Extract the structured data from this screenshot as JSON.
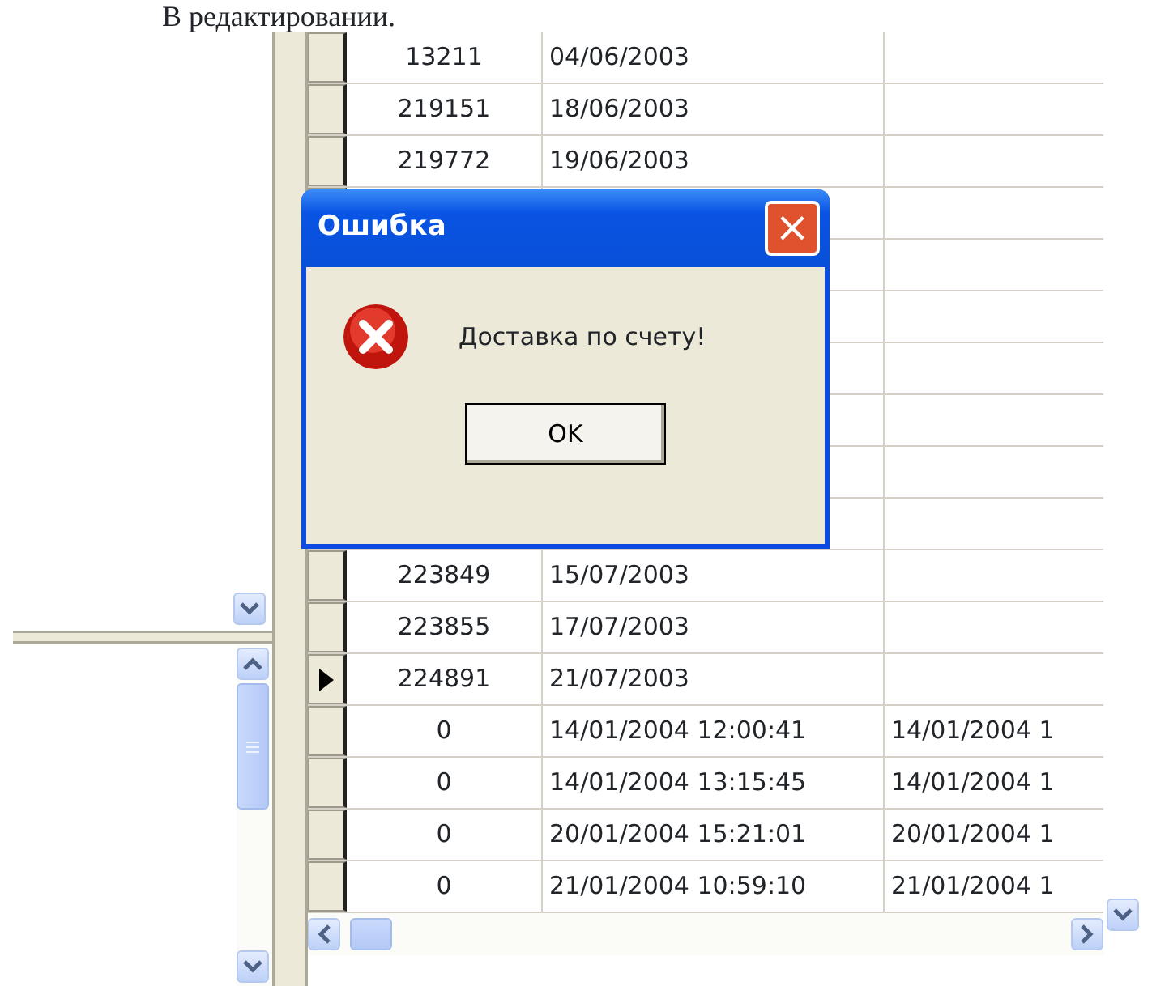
{
  "caption": "В редактировании.",
  "grid": {
    "rows": [
      {
        "number": "13211",
        "date": "04/06/2003",
        "current": false
      },
      {
        "number": "219151",
        "date": "18/06/2003",
        "current": false
      },
      {
        "number": "219772",
        "date": "19/06/2003",
        "current": false
      },
      {
        "number": "223849",
        "date": "15/07/2003",
        "current": false
      },
      {
        "number": "223855",
        "date": "17/07/2003",
        "current": false
      },
      {
        "number": "224891",
        "date": "21/07/2003",
        "current": true
      },
      {
        "number": "0",
        "date": "14/01/2004 12:00:41",
        "date_2": "14/01/2004 1",
        "current": false
      },
      {
        "number": "0",
        "date": "14/01/2004 13:15:45",
        "date_2": "14/01/2004 1",
        "current": false
      },
      {
        "number": "0",
        "date": "20/01/2004 15:21:01",
        "date_2": "20/01/2004 1",
        "current": false
      },
      {
        "number": "0",
        "date": "21/01/2004 10:59:10",
        "date_2": "21/01/2004 1",
        "current": false
      }
    ]
  },
  "dialog": {
    "title": "Ошибка",
    "close": "×",
    "message": "Доставка по счету!",
    "button": "OK"
  }
}
